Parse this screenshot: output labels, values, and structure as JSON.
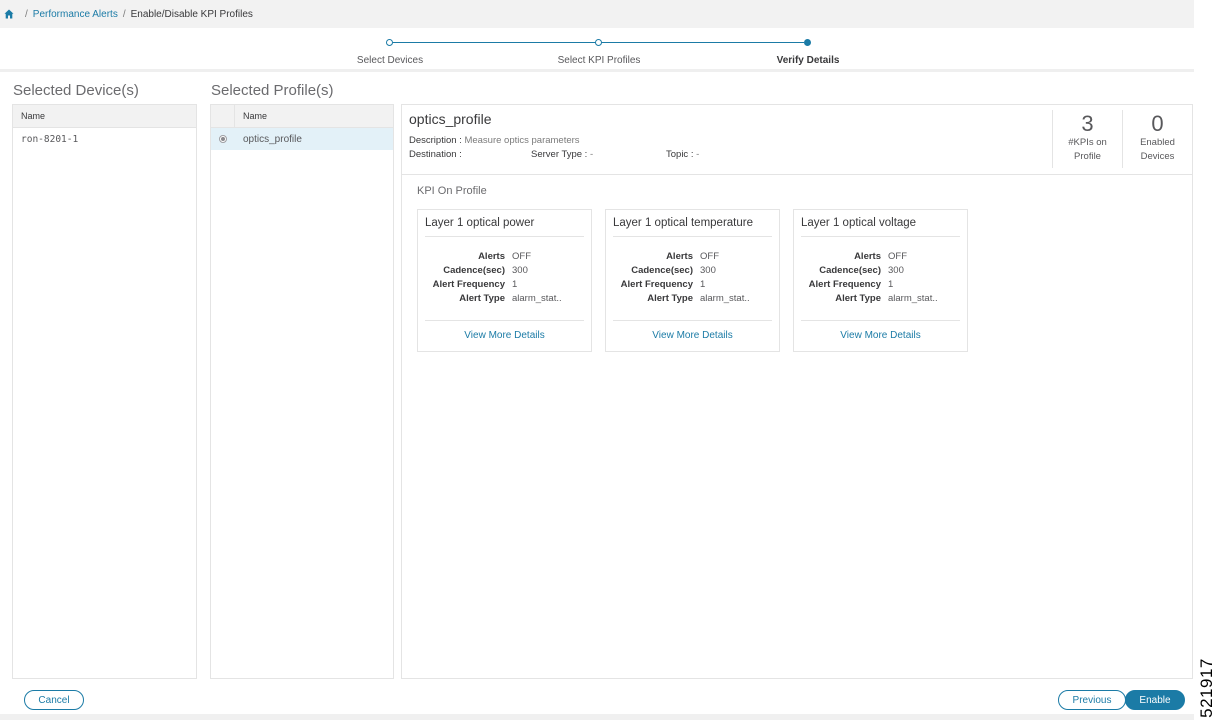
{
  "breadcrumb": {
    "home_icon": "home-icon",
    "items": [
      "Performance Alerts",
      "Enable/Disable KPI Profiles"
    ],
    "separator": "/"
  },
  "wizard": {
    "steps": [
      {
        "label": "Select Devices",
        "state": "complete"
      },
      {
        "label": "Select KPI Profiles",
        "state": "complete"
      },
      {
        "label": "Verify Details",
        "state": "active"
      }
    ]
  },
  "devices": {
    "title": "Selected Device(s)",
    "column": "Name",
    "rows": [
      "ron-8201-1"
    ]
  },
  "profiles": {
    "title": "Selected Profile(s)",
    "column": "Name",
    "rows": [
      {
        "name": "optics_profile",
        "selected": true
      }
    ]
  },
  "detail": {
    "profile_name": "optics_profile",
    "description_label": "Description :",
    "description_value": "Measure optics parameters",
    "destination_label": "Destination :",
    "server_type_label": "Server Type :",
    "server_type_value": "-",
    "topic_label": "Topic :",
    "topic_value": "-",
    "stats": [
      {
        "value": "3",
        "label_line1": "#KPIs on",
        "label_line2": "Profile"
      },
      {
        "value": "0",
        "label_line1": "Enabled",
        "label_line2": "Devices"
      }
    ],
    "kpi_section_title": "KPI On Profile",
    "kpis": [
      {
        "title": "Layer 1 optical power",
        "alerts": "OFF",
        "cadence": "300",
        "alert_frequency": "1",
        "alert_type": "alarm_stat..",
        "link": "View More Details"
      },
      {
        "title": "Layer 1 optical temperature",
        "alerts": "OFF",
        "cadence": "300",
        "alert_frequency": "1",
        "alert_type": "alarm_stat..",
        "link": "View More Details"
      },
      {
        "title": "Layer 1 optical voltage",
        "alerts": "OFF",
        "cadence": "300",
        "alert_frequency": "1",
        "alert_type": "alarm_stat..",
        "link": "View More Details"
      }
    ],
    "kpi_labels": {
      "alerts": "Alerts",
      "cadence": "Cadence(sec)",
      "alert_frequency": "Alert Frequency",
      "alert_type": "Alert Type"
    }
  },
  "footer": {
    "cancel": "Cancel",
    "previous": "Previous",
    "enable": "Enable"
  },
  "watermark": "521917",
  "colors": {
    "accent": "#1b7ba6",
    "selected_row": "#e3f1f8",
    "header_bg": "#f2f2f2"
  }
}
